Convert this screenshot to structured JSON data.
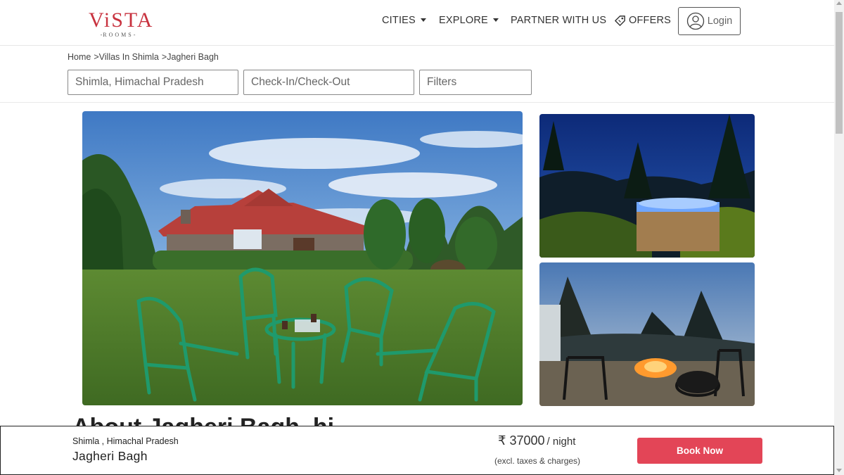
{
  "brand": {
    "logo_main": "ViSTA",
    "logo_sub": "ROOMS"
  },
  "nav": {
    "cities": "CITIES",
    "explore": "EXPLORE",
    "partner": "PARTNER WITH US",
    "offers": "OFFERS",
    "login": "Login"
  },
  "breadcrumb": [
    "Home",
    "Villas In Shimla",
    "Jagheri Bagh"
  ],
  "breadcrumb_separator": ">",
  "search": {
    "location_value": "Shimla, Himachal Pradesh",
    "dates_placeholder": "Check-In/Check-Out",
    "filters_label": "Filters"
  },
  "gallery": [
    {
      "name": "lawn-and-cottage-photo"
    },
    {
      "name": "hot-tub-night-photo"
    },
    {
      "name": "firepit-dusk-photo"
    }
  ],
  "about_heading_peek": "About Jagheri Bagh, hi",
  "booking_bar": {
    "location": "Shimla , Himachal Pradesh",
    "property_name": "Jagheri Bagh",
    "price": "₹ 37000",
    "price_unit": "/ night",
    "tax_note": "(excl. taxes & charges)",
    "book_label": "Book Now"
  },
  "colors": {
    "brand_red": "#c8323f",
    "book_button": "#e34557"
  }
}
